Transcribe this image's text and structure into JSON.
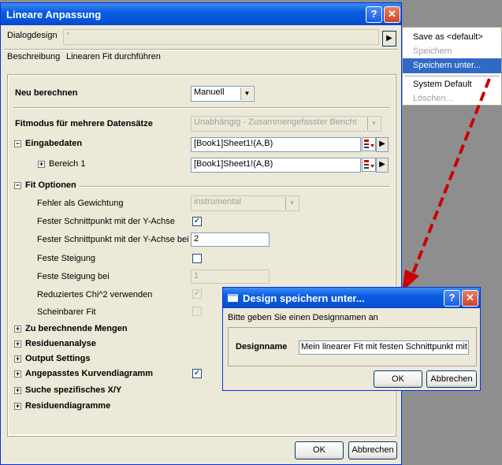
{
  "main_window": {
    "title": "Lineare Anpassung",
    "help_glyph": "?",
    "close_glyph": "✕",
    "dialogdesign_label": "Dialogdesign",
    "dialogdesign_value": "*",
    "beschreibung_label": "Beschreibung",
    "beschreibung_value": "Linearen Fit durchführen",
    "neu_berechnen_label": "Neu berechnen",
    "neu_berechnen_value": "Manuell",
    "fitmodus_label": "Fitmodus für mehrere Datensätze",
    "fitmodus_value": "Unabhängig - Zusammengefasster Bericht",
    "eingabedaten_label": "Eingabedaten",
    "eingabedaten_value": "[Book1]Sheet1!(A,B)",
    "bereich_label": "Bereich 1",
    "bereich_value": "[Book1]Sheet1!(A,B)",
    "fit_optionen_label": "Fit Optionen",
    "fehler_label": "Fehler als Gewichtung",
    "fehler_value": "instrumental",
    "fester_schnittpunkt_label": "Fester Schnittpunkt mit der Y-Achse",
    "fester_schnittpunkt_bei_label": "Fester Schnittpunkt mit der Y-Achse bei",
    "fester_schnittpunkt_bei_value": "2",
    "feste_steigung_label": "Feste Steigung",
    "feste_steigung_bei_label": "Feste Steigung bei",
    "feste_steigung_bei_value": "1",
    "reduziertes_label": "Reduziertes Chi^2 verwenden",
    "scheinbarer_label": "Scheinbarer Fit",
    "sections": [
      "Zu berechnende Mengen",
      "Residuenanalyse",
      "Output Settings",
      "Angepasstes Kurvendiagramm",
      "Suche spezifisches X/Y",
      "Residuendiagramme"
    ],
    "checkmark": "✓",
    "ok_label": "OK",
    "cancel_label": "Abbrechen"
  },
  "menu": {
    "items": [
      "Save as <default>",
      "Speichern",
      "Speichern unter...",
      "System Default",
      "Löschen..."
    ]
  },
  "save_dialog": {
    "title": "Design speichern unter...",
    "prompt": "Bitte geben Sie einen Designnamen an",
    "name_label": "Designname",
    "name_value": "Mein linearer Fit mit festen Schnittpunkt mit",
    "ok_label": "OK",
    "cancel_label": "Abbrechen"
  },
  "colors": {
    "titlebar": "#0a5ce0",
    "menu_highlight": "#316ac5",
    "arrow": "#cc0000"
  }
}
